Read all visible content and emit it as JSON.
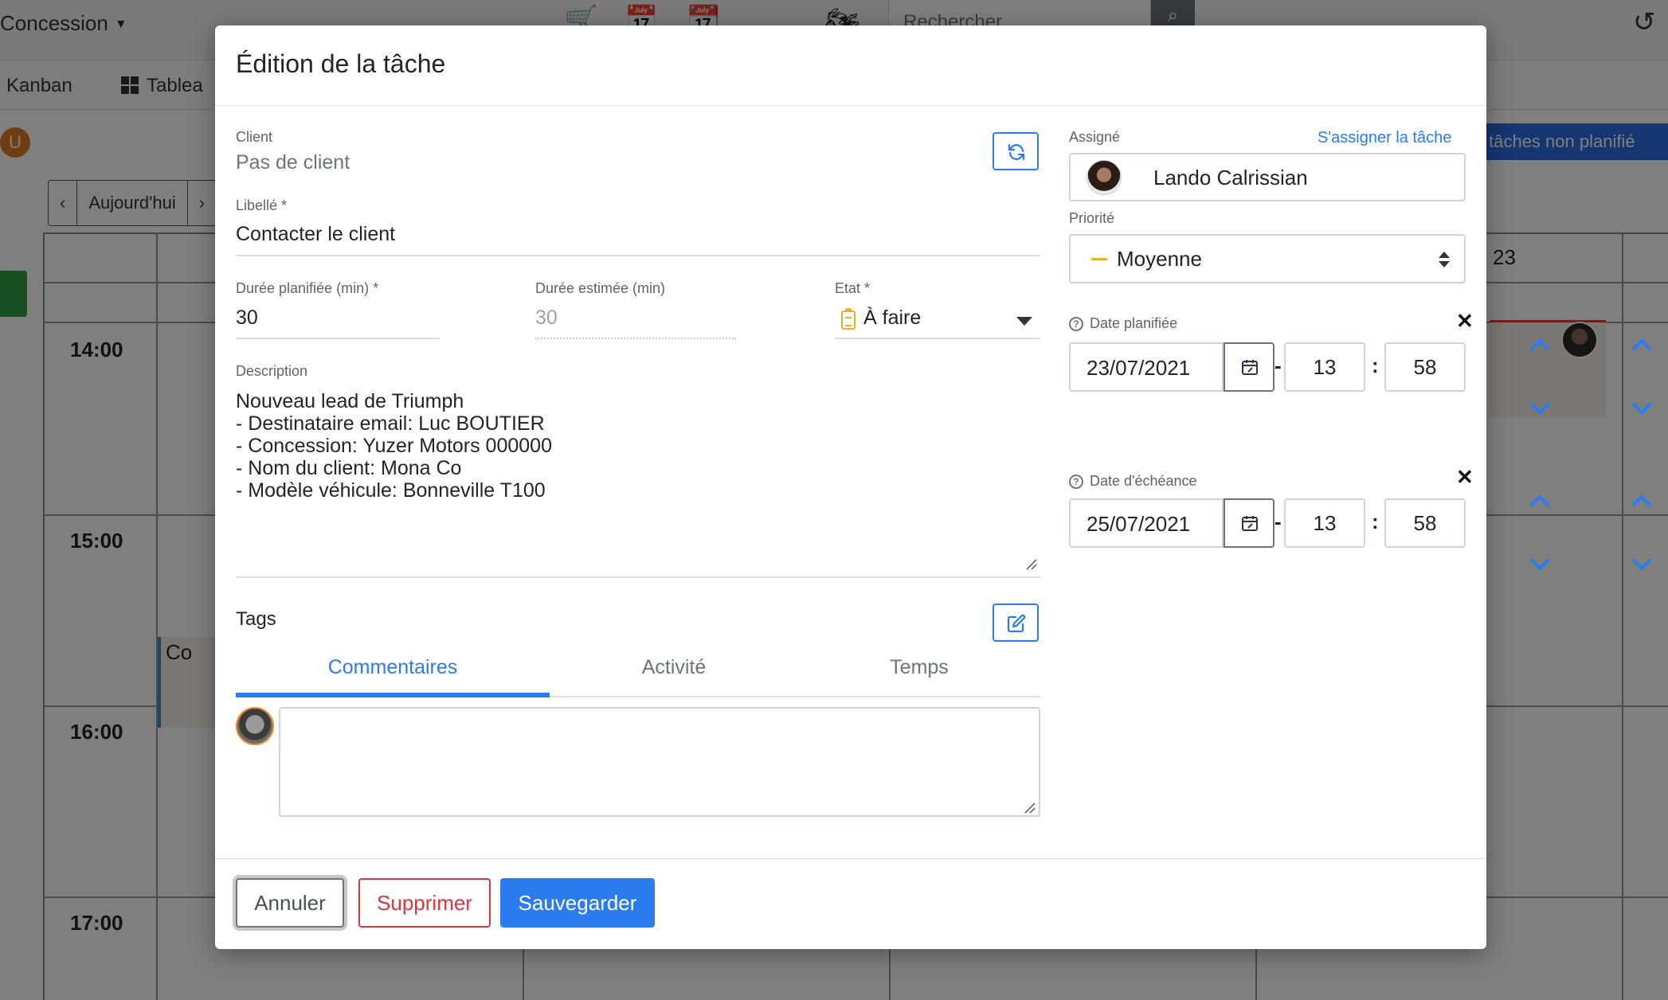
{
  "background": {
    "concession_label": "Concession",
    "search_placeholder": "Rechercher",
    "view_kanban": "Kanban",
    "view_tableau": "Tablea",
    "user_initial": "U",
    "unplanned_button": "s tâches non planifié",
    "nav_today": "Aujourd'hui",
    "nav_prev": "‹",
    "nav_next": "›",
    "day_number": "23",
    "hours": [
      "14:00",
      "15:00",
      "16:00",
      "17:00"
    ],
    "event_left_text": "Co"
  },
  "modal": {
    "title": "Édition de la tâche",
    "client": {
      "label": "Client",
      "value": "Pas de client"
    },
    "libelle": {
      "label": "Libellé *",
      "value": "Contacter le client"
    },
    "duree_planifiee": {
      "label": "Durée planifiée (min) *",
      "value": "30"
    },
    "duree_estimee": {
      "label": "Durée estimée (min)",
      "placeholder": "30"
    },
    "etat": {
      "label": "Etat *",
      "value": "À faire"
    },
    "description": {
      "label": "Description",
      "text": "Nouveau lead de Triumph\n- Destinataire email: Luc BOUTIER\n- Concession: Yuzer Motors 000000\n- Nom du client: Mona Co\n- Modèle véhicule: Bonneville T100"
    },
    "tags": {
      "label": "Tags"
    },
    "tabs": [
      {
        "label": "Commentaires",
        "active": true
      },
      {
        "label": "Activité",
        "active": false
      },
      {
        "label": "Temps",
        "active": false
      }
    ],
    "assigne": {
      "label": "Assigné",
      "link": "S'assigner la tâche",
      "value": "Lando Calrissian"
    },
    "priorite": {
      "label": "Priorité",
      "value": "Moyenne",
      "color": "#f0ad1f"
    },
    "date_planifiee": {
      "label": "Date planifiée",
      "date": "23/07/2021",
      "hour": "13",
      "minute": "58"
    },
    "date_echeance": {
      "label": "Date d'échéance",
      "date": "25/07/2021",
      "hour": "13",
      "minute": "58"
    },
    "time_separator_dash": "-",
    "time_separator_colon": ":",
    "clear_symbol": "✕",
    "buttons": {
      "cancel": "Annuler",
      "delete": "Supprimer",
      "save": "Sauvegarder"
    }
  },
  "colors": {
    "primary": "#2b7cf0",
    "danger": "#d9363e",
    "warning": "#f0ad1f"
  }
}
